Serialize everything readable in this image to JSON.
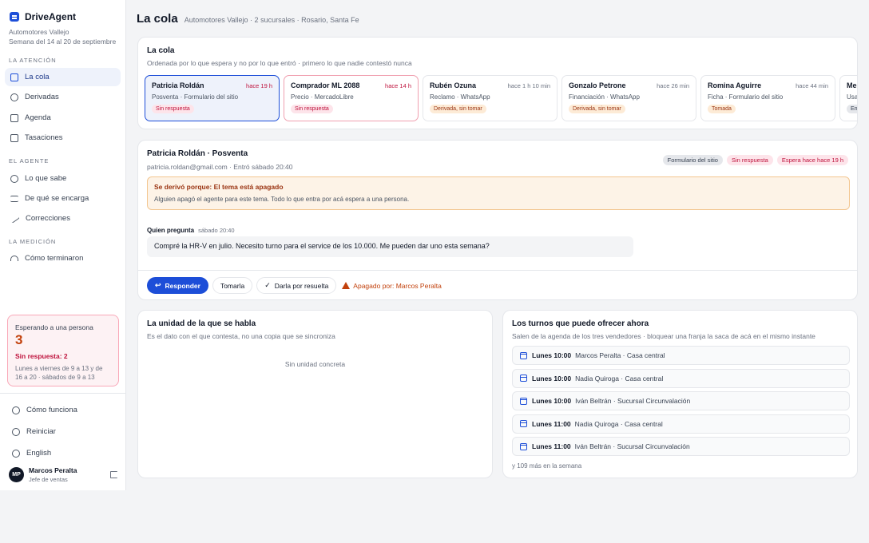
{
  "app": {
    "name": "DriveAgent",
    "account": "Automotores Vallejo",
    "week": "Semana del 14 al 20 de septiembre"
  },
  "sidebar": {
    "sections": [
      {
        "label": "La atención",
        "items": [
          {
            "label": "La cola",
            "icon": "inbox-icon",
            "active": true
          },
          {
            "label": "Derivadas",
            "icon": "user-forward-icon"
          },
          {
            "label": "Agenda",
            "icon": "calendar-icon"
          },
          {
            "label": "Tasaciones",
            "icon": "clipboard-icon"
          }
        ]
      },
      {
        "label": "El agente",
        "items": [
          {
            "label": "Lo que sabe",
            "icon": "car-icon"
          },
          {
            "label": "De qué se encarga",
            "icon": "sliders-icon"
          },
          {
            "label": "Correcciones",
            "icon": "pencil-icon"
          }
        ]
      },
      {
        "label": "La medición",
        "items": [
          {
            "label": "Cómo terminaron",
            "icon": "gauge-icon"
          }
        ]
      }
    ],
    "waiting": {
      "title": "Esperando a una persona",
      "count": "3",
      "unanswered": "Sin respuesta: 2",
      "hours": "Lunes a viernes de 9 a 13 y de 16 a 20 · sábados de 9 a 13"
    },
    "footer": {
      "how_it_works": "Cómo funciona",
      "restart": "Reiniciar",
      "language": "English"
    },
    "user": {
      "initials": "MP",
      "name": "Marcos Peralta",
      "role": "Jefe de ventas"
    }
  },
  "header": {
    "title": "La cola",
    "subtitle": "Automotores Vallejo · 2 sucursales · Rosario, Santa Fe"
  },
  "queue": {
    "title": "La cola",
    "subtitle": "Ordenada por lo que espera y no por lo que entró · primero lo que nadie contestó nunca",
    "items": [
      {
        "name": "Patricia Roldán",
        "time": "hace 19 h",
        "meta": "Posventa · Formulario del sitio",
        "badge": "Sin respuesta"
      },
      {
        "name": "Comprador ML 2088",
        "time": "hace 14 h",
        "meta": "Precio · MercadoLibre",
        "badge": "Sin respuesta"
      },
      {
        "name": "Rubén Ozuna",
        "time": "hace 1 h 10 min",
        "meta": "Reclamo · WhatsApp",
        "badge": "Derivada, sin tomar"
      },
      {
        "name": "Gonzalo Petrone",
        "time": "hace 26 min",
        "meta": "Financiación · WhatsApp",
        "badge": "Derivada, sin tomar"
      },
      {
        "name": "Romina Aguirre",
        "time": "hace 44 min",
        "meta": "Ficha · Formulario del sitio",
        "badge": "Tomada"
      },
      {
        "name": "Mel",
        "time": "",
        "meta": "Usad",
        "badge": "En"
      }
    ]
  },
  "detail": {
    "title": "Patricia Roldán · Posventa",
    "subtitle": "patricia.roldan@gmail.com · Entró sábado 20:40",
    "badges": [
      "Formulario del sitio",
      "Sin respuesta",
      "Espera hace hace 19 h"
    ],
    "warning_title": "Se derivó porque: El tema está apagado",
    "warning_text": "Alguien apagó el agente para este tema. Todo lo que entra por acá espera a una persona.",
    "message_who": "Quien pregunta",
    "message_when": "sábado 20:40",
    "message_text": "Compré la HR-V en julio. Necesito turno para el service de los 10.000. Me pueden dar uno esta semana?",
    "actions": {
      "reply": "Responder",
      "take": "Tomarla",
      "resolve": "Darla por resuelta",
      "off_note": "Apagado por: Marcos Peralta"
    }
  },
  "unit": {
    "title": "La unidad de la que se habla",
    "subtitle": "Es el dato con el que contesta, no una copia que se sincroniza",
    "empty": "Sin unidad concreta"
  },
  "slots": {
    "title": "Los turnos que puede ofrecer ahora",
    "subtitle": "Salen de la agenda de los tres vendedores · bloquear una franja la saca de acá en el mismo instante",
    "items": [
      {
        "day": "Lunes 10:00",
        "detail": "Marcos Peralta · Casa central"
      },
      {
        "day": "Lunes 10:00",
        "detail": "Nadia Quiroga · Casa central"
      },
      {
        "day": "Lunes 10:00",
        "detail": "Iván Beltrán · Sucursal Circunvalación"
      },
      {
        "day": "Lunes 11:00",
        "detail": "Nadia Quiroga · Casa central"
      },
      {
        "day": "Lunes 11:00",
        "detail": "Iván Beltrán · Sucursal Circunvalación"
      }
    ],
    "more": "y 109 más en la semana"
  },
  "colors": {
    "accent": "#1d4ed8",
    "alert": "#be123c",
    "warning": "#c2410c"
  }
}
